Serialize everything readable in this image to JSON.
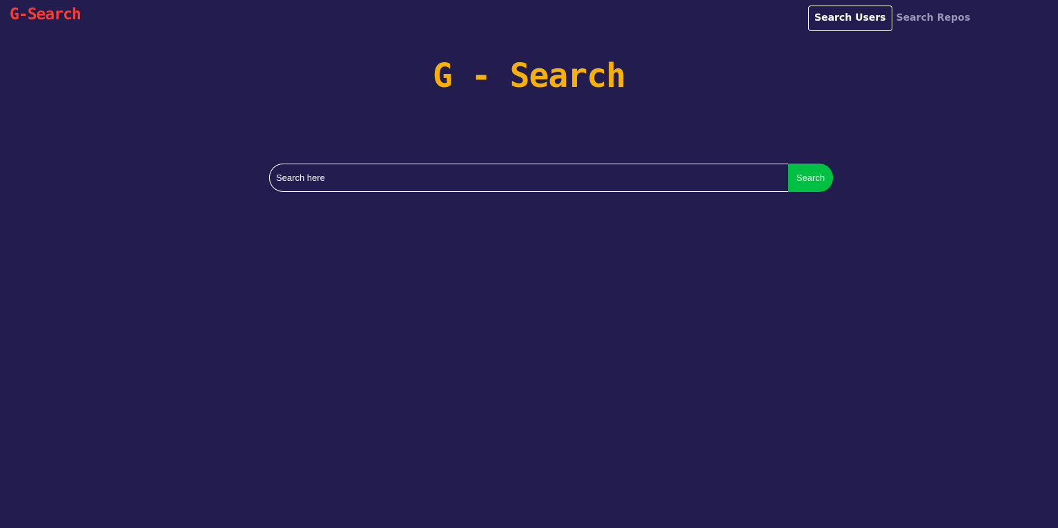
{
  "navbar": {
    "brand": "G-Search",
    "links": [
      {
        "label": "Search Users",
        "active": true
      },
      {
        "label": "Search Repos",
        "active": false
      }
    ]
  },
  "hero": {
    "title": "G - Search"
  },
  "search": {
    "placeholder": "Search here",
    "value": "",
    "button_label": "Search"
  },
  "colors": {
    "background": "#221c4f",
    "brand": "#ff3a2e",
    "title": "#f5b10a",
    "button": "#00c043",
    "inactive_link": "#9a96b8"
  }
}
